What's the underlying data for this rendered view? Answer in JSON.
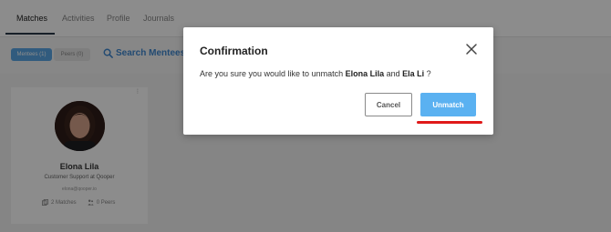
{
  "nav": {
    "tabs": [
      {
        "label": "Matches"
      },
      {
        "label": "Activities"
      },
      {
        "label": "Profile"
      },
      {
        "label": "Journals"
      }
    ]
  },
  "filters": {
    "mentees_label": "Mentees (1)",
    "peers_label": "Peers (0)",
    "search_label": "Search Mentees"
  },
  "card": {
    "kebab": "⋮",
    "name": "Elona Lila",
    "role": "Customer Support at Qooper",
    "email": "elona@qooper.io",
    "matches": "2 Matches",
    "peers": "0 Peers"
  },
  "modal": {
    "title": "Confirmation",
    "message_prefix": "Are you sure you would like to unmatch ",
    "name_a": "Elona Lila",
    "message_mid": " and ",
    "name_b": "Ela Li",
    "message_suffix": " ?",
    "cancel_label": "Cancel",
    "confirm_label": "Unmatch"
  },
  "colors": {
    "accent": "#5ab1f1",
    "link": "#3f88d0",
    "annotation": "#e01919"
  }
}
